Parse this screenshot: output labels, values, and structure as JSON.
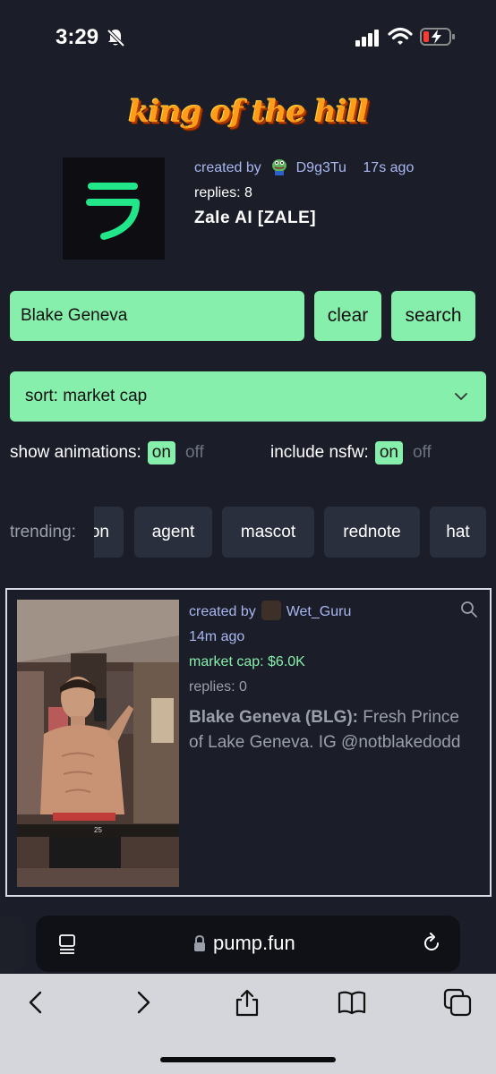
{
  "status_bar": {
    "time": "3:29"
  },
  "king_of_the_hill": {
    "title": "king of the hill",
    "created_by_label": "created by",
    "creator": "D9g3Tu",
    "time_ago": "17s ago",
    "replies": "replies: 8",
    "token_name": "Zale AI [ZALE]",
    "logo_glyph": "ラ"
  },
  "search": {
    "value": "Blake Geneva",
    "clear_label": "clear",
    "search_label": "search"
  },
  "sort": {
    "label": "sort: market cap"
  },
  "toggles": {
    "animations_label": "show animations:",
    "nsfw_label": "include nsfw:",
    "on_label": "on",
    "off_label": "off"
  },
  "trending": {
    "label": "trending:",
    "chips": [
      "on",
      "agent",
      "mascot",
      "rednote",
      "hat"
    ]
  },
  "coin": {
    "created_by_label": "created by",
    "creator": "Wet_Guru",
    "time_ago": "14m ago",
    "market_cap": "market cap: $6.0K",
    "replies": "replies: 0",
    "name": "Blake Geneva (BLG):",
    "description": "Fresh Prince of Lake Geneva. IG @notblakedodd",
    "image_caption": "25"
  },
  "browser": {
    "url": "pump.fun"
  },
  "colors": {
    "accent_green": "#86efac",
    "background": "#1b1d28",
    "link_blue": "#a8b7f0"
  }
}
